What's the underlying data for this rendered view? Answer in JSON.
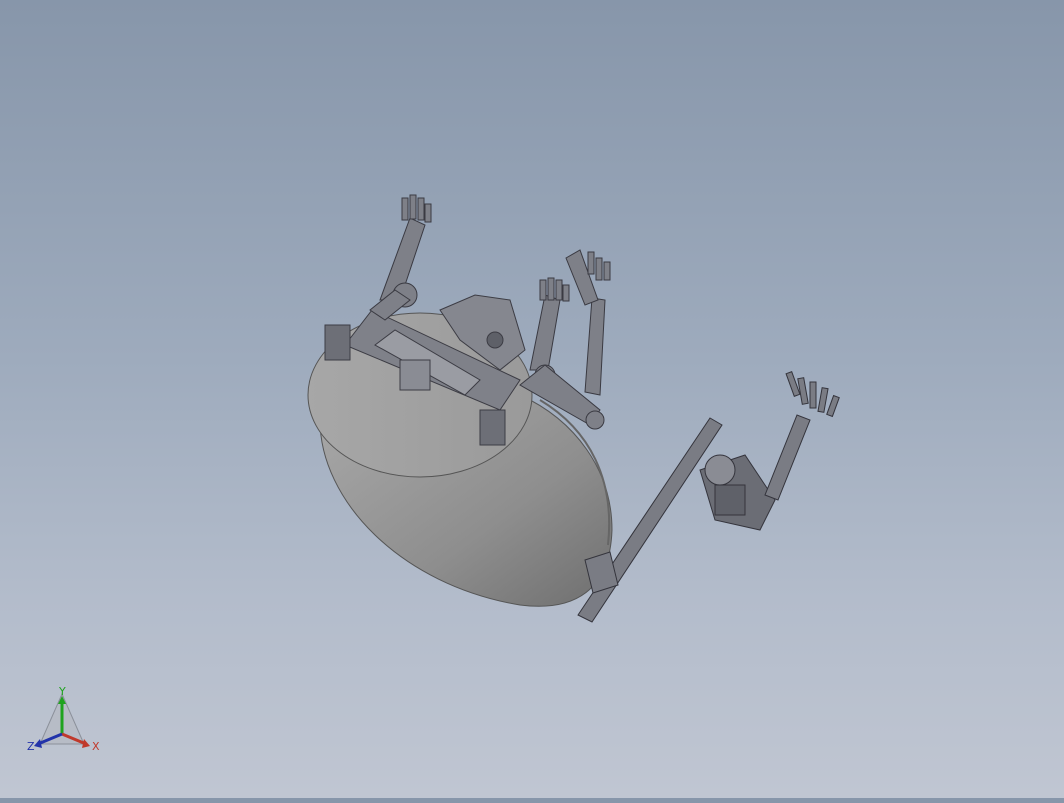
{
  "viewport": {
    "background_top": "#8796aa",
    "background_bottom": "#c0c6d2",
    "model_color": "#9c9c9c",
    "part_color": "#7d7f86"
  },
  "triad": {
    "y_label": "Y",
    "x_label": "X",
    "z_label": "Z",
    "y_color": "#1fa31f",
    "x_color": "#c0392b",
    "z_color": "#2233aa"
  }
}
